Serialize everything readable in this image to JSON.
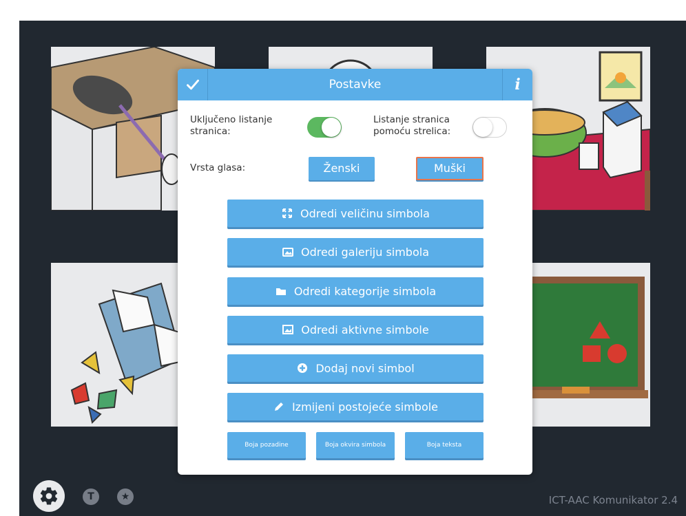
{
  "dialog": {
    "title": "Postavke",
    "confirm_icon": "checkmark-icon",
    "info_icon": "info-icon"
  },
  "settings": {
    "page_scroll_label": "Uključeno listanje stranica:",
    "page_scroll_enabled": true,
    "arrow_scroll_label": "Listanje stranica pomoću strelica:",
    "arrow_scroll_enabled": false,
    "voice_label": "Vrsta glasa:",
    "voice_options": [
      "Ženski",
      "Muški"
    ],
    "voice_selected": "Muški"
  },
  "actions": [
    {
      "label": "Odredi veličinu simbola",
      "icon": "resize-icon"
    },
    {
      "label": "Odredi galeriju simbola",
      "icon": "gallery-icon"
    },
    {
      "label": "Odredi kategorije simbola",
      "icon": "folder-icon"
    },
    {
      "label": "Odredi aktivne simbole",
      "icon": "image-icon"
    },
    {
      "label": "Dodaj novi simbol",
      "icon": "plus-circle-icon"
    },
    {
      "label": "Izmijeni postojeće simbole",
      "icon": "pencil-icon"
    }
  ],
  "color_buttons": [
    "Boja pozadine",
    "Boja okvira simbola",
    "Boja teksta"
  ],
  "footer": {
    "icons": [
      "gear-icon",
      "text-icon",
      "star-icon"
    ],
    "version": "ICT-AAC Komunikator 2.4"
  },
  "colors": {
    "background": "#212830",
    "accent": "#5aaee8",
    "toggle_on": "#5cb860",
    "selected_border": "#e8744a"
  }
}
